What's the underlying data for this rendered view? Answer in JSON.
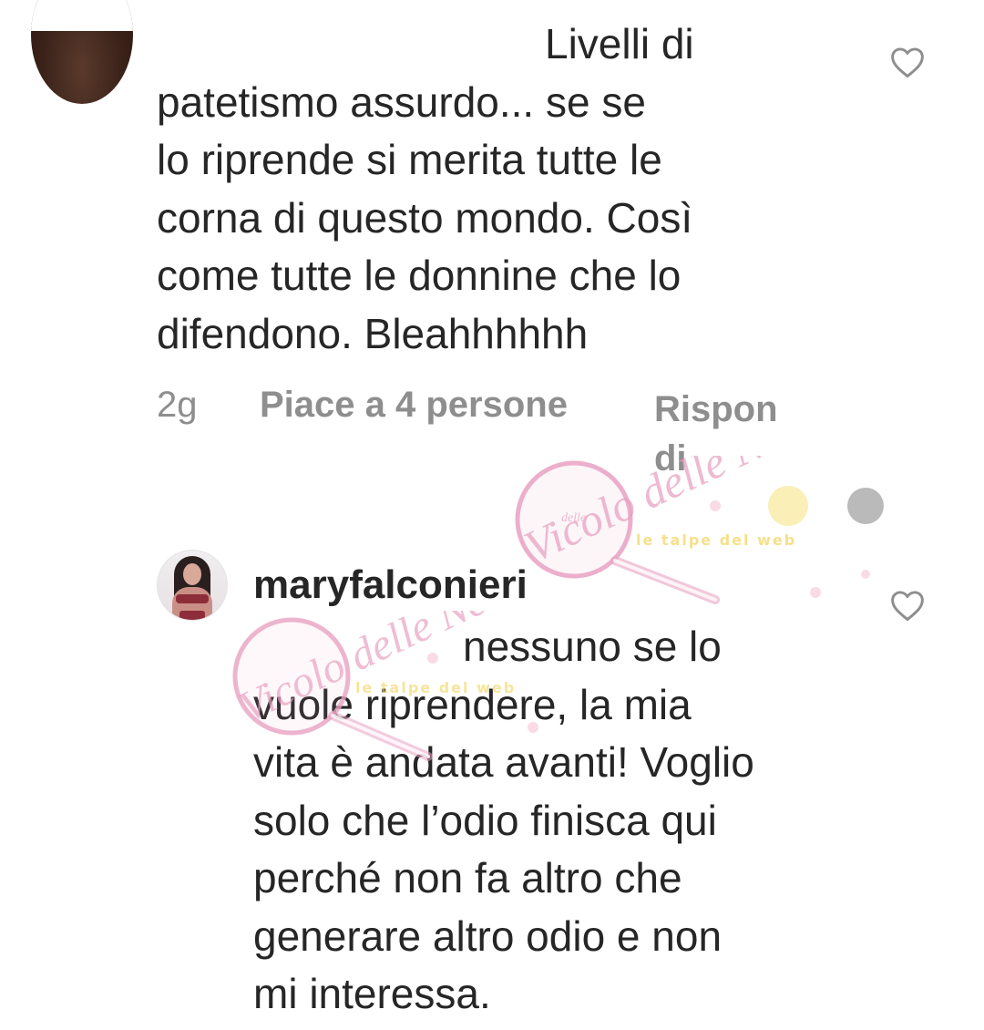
{
  "comments": [
    {
      "avatar_icon": "user-avatar-icon",
      "text_lines": [
        "Livelli di",
        "patetismo assurdo... se se",
        "lo riprende si merita tutte le",
        "corna di questo mondo. Così",
        "come tutte le donnine che lo",
        "difendono. Bleahhhhhh"
      ],
      "time": "2g",
      "likes": "Piace a 4 persone",
      "reply": "Rispon di",
      "reply_lines": [
        "Rispon",
        "di"
      ]
    },
    {
      "avatar_icon": "maryfalconieri-avatar-icon",
      "username": "maryfalconieri",
      "text_lines": [
        "nessuno se lo",
        "vuole riprendere, la mia",
        "vita è andata avanti! Voglio",
        "solo che l’odio finisca qui",
        "perché non fa altro che",
        "generare altro odio e non",
        "mi interessa."
      ]
    }
  ],
  "watermark": {
    "brand": "Vicolo delle News",
    "brand_small": "delle",
    "tagline": "le talpe del web"
  },
  "colors": {
    "text": "#262626",
    "meta": "#8e8e8e",
    "watermark_pink": "#e9a2c2",
    "watermark_yellow": "#f2d35a"
  }
}
